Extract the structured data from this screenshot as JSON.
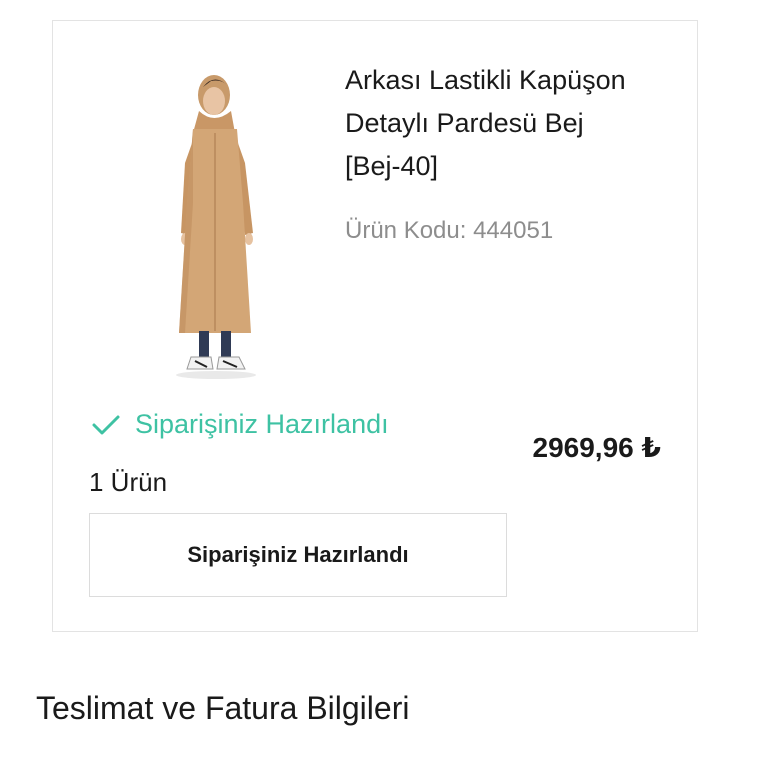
{
  "product": {
    "title": "Arkası Lastikli Kapüşon\nDetaylı Pardesü Bej\n[Bej-40]",
    "code": "Ürün Kodu: 444051",
    "image_icon": "long-beige-coat-photo"
  },
  "order": {
    "status": "Siparişiniz Hazırlandı",
    "status_icon": "check-icon",
    "item_count": "1 Ürün",
    "price": "2969,96 ₺",
    "button_label": "Siparişiniz Hazırlandı"
  },
  "section": {
    "title": "Teslimat ve Fatura Bilgileri"
  },
  "colors": {
    "status_green": "#3ec2a3",
    "muted_text": "#8d8d8d",
    "border": "#e3e3e3"
  }
}
